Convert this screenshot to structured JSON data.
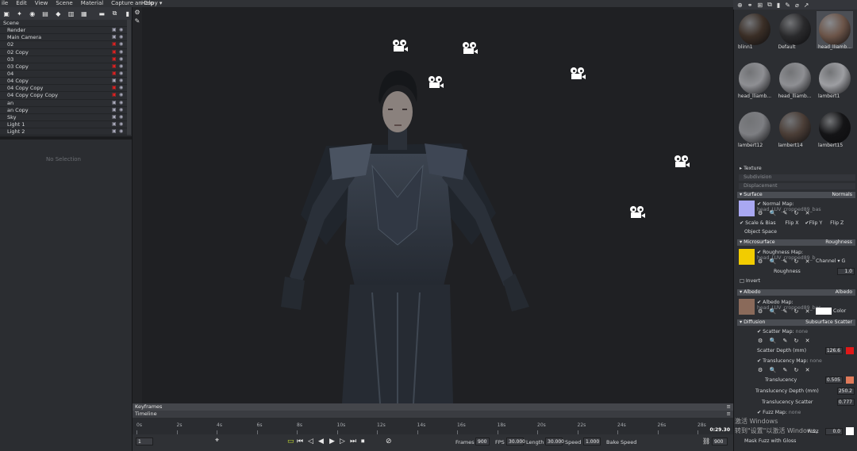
{
  "menu": [
    "ile",
    "Edit",
    "View",
    "Scene",
    "Material",
    "Capture",
    "Help"
  ],
  "window_controls": [
    "–",
    "/",
    "×"
  ],
  "viewport_title": "an Copy ▾",
  "scene_tree": [
    {
      "label": "Scene",
      "hidden_toggle": false
    },
    {
      "label": "Render"
    },
    {
      "label": "Main Camera"
    },
    {
      "label": "02",
      "red": true
    },
    {
      "label": "02 Copy",
      "red": true
    },
    {
      "label": "03",
      "red": true
    },
    {
      "label": "03 Copy",
      "red": true
    },
    {
      "label": "04",
      "red": true
    },
    {
      "label": "04 Copy"
    },
    {
      "label": "04 Copy Copy",
      "red": true
    },
    {
      "label": "04 Copy Copy Copy",
      "red": true
    },
    {
      "label": "an"
    },
    {
      "label": "an Copy"
    },
    {
      "label": "Sky"
    },
    {
      "label": "Light 1"
    },
    {
      "label": "Light 2"
    }
  ],
  "no_selection": "No Selection",
  "timeline": {
    "keyframes_label": "Keyframes",
    "timeline_label": "Timeline",
    "ruler": [
      "0s",
      "2s",
      "4s",
      "6s",
      "8s",
      "10s",
      "12s",
      "14s",
      "16s",
      "18s",
      "20s",
      "22s",
      "24s",
      "26s",
      "28s"
    ],
    "end_time": "0:29.30",
    "frame": "1",
    "frames_label": "Frames",
    "frames_value": "900",
    "fps_label": "FPS",
    "fps_value": "30.000",
    "length_label": "Length",
    "length_value": "30.000",
    "speed_label": "Speed",
    "speed_value": "1.000",
    "bake_speed_label": "Bake Speed",
    "end_frame": "900"
  },
  "materials": [
    {
      "label": "blinn1",
      "color": "#3a2e26"
    },
    {
      "label": "Default",
      "color": "#2a2a2c"
    },
    {
      "label": "head_lliamb...",
      "color": "#6b5448",
      "selected": true
    },
    {
      "label": "head_lliamb...",
      "color": "#8e8f93"
    },
    {
      "label": "head_lliamb...",
      "color": "#8e8f93"
    },
    {
      "label": "lambert1",
      "color": "#9d9ea2"
    },
    {
      "label": "lambert12",
      "color": "#7d7e82"
    },
    {
      "label": "lambert14",
      "color": "#4a3d36"
    },
    {
      "label": "lambert15",
      "color": "#141416"
    }
  ],
  "panel": {
    "texture": "Texture",
    "subdivision": "Subdivision",
    "displacement": "Displacement",
    "surface": "Surface",
    "surface_type": "Normals",
    "normal_map": "Normal Map:",
    "normal_map_file": "head_LUV_cropped89_bas",
    "scale_bias": "Scale & Bias",
    "flip_x": "Flip X",
    "flip_y": "Flip Y",
    "flip_z": "Flip Z",
    "object_space": "Object Space",
    "microsurface": "Microsurface",
    "microsurface_type": "Roughness",
    "roughness_map": "Roughness Map:",
    "roughness_map_file": "head_LUV_cropped89_b",
    "channel": "Channel",
    "channel_value": "G",
    "roughness": "Roughness",
    "roughness_value": "1.0",
    "invert": "Invert",
    "albedo": "Albedo",
    "albedo_type": "Albedo",
    "albedo_map": "Albedo Map:",
    "albedo_map_file": "head_LUV_cropped89_bas",
    "color": "Color",
    "diffusion": "Diffusion",
    "diffusion_type": "Subsurface Scatter",
    "scatter_map": "Scatter Map:",
    "scatter_map_file": "none",
    "scatter_depth": "Scatter Depth (mm)",
    "scatter_depth_value": "126.6",
    "translucency_map": "Translucency Map:",
    "translucency_map_file": "none",
    "translucency": "Translucency",
    "translucency_value": "0.505",
    "translucency_depth": "Translucency Depth (mm)",
    "translucency_depth_value": "250.2",
    "translucency_scatter": "Translucency Scatter",
    "translucency_scatter_value": "0.777",
    "fuzz_map": "Fuzz Map:",
    "fuzz_map_file": "none",
    "fuzz": "Fuzz",
    "fuzz_value": "0.0",
    "mask_fuzz": "Mask Fuzz with Gloss"
  },
  "watermark": "激活 Windows\n转到\"设置\"以激活 Windows。",
  "colors": {
    "normal_swatch": "#a9a8f2",
    "roughness_swatch": "#f2cc00",
    "albedo_swatch": "#8a6a5a",
    "scatter_color": "#e01818",
    "translucency_color": "#e07a5a"
  }
}
